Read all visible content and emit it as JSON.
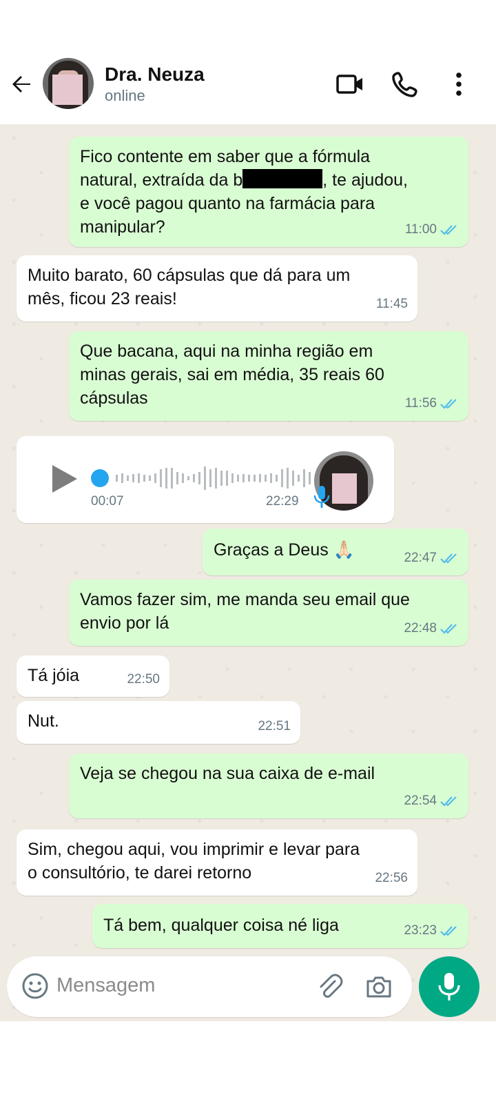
{
  "header": {
    "contact_name": "Dra. Neuza",
    "status": "online"
  },
  "messages": [
    {
      "direction": "out",
      "text_before": "Fico contente em saber que a fórmula\nnatural, extraída da b",
      "text_after": ", te ajudou,\ne você pagou quanto na farmácia para\nmanipular?",
      "time": "11:00",
      "read": true
    },
    {
      "direction": "in",
      "text": "Muito barato, 60 cápsulas que dá para um\nmês, ficou 23 reais!",
      "time": "11:45"
    },
    {
      "direction": "out",
      "text": "Que bacana, aqui na minha região em\nminas gerais, sai em média, 35 reais 60\ncápsulas",
      "time": "11:56",
      "read": true
    },
    {
      "direction": "in",
      "type": "audio",
      "duration": "00:07",
      "time": "22:29"
    },
    {
      "direction": "out",
      "text": "Graças a Deus 🙏🏻",
      "time": "22:47",
      "read": true
    },
    {
      "direction": "out",
      "text": "Vamos fazer sim, me manda seu email que\nenvio por lá",
      "time": "22:48",
      "read": true
    },
    {
      "direction": "in",
      "text": "Tá jóia",
      "time": "22:50"
    },
    {
      "direction": "in",
      "text": "Nut.",
      "time": "22:51"
    },
    {
      "direction": "out",
      "text": "Veja se chegou na sua caixa de e-mail",
      "time": "22:54",
      "read": true
    },
    {
      "direction": "in",
      "text": "Sim, chegou aqui, vou imprimir e levar para\no consultório, te darei retorno",
      "time": "22:56"
    },
    {
      "direction": "out",
      "text": "Tá bem, qualquer coisa né liga",
      "time": "23:23",
      "read": true
    }
  ],
  "composer": {
    "placeholder": "Mensagem"
  },
  "colors": {
    "outgoing_bubble": "#d9fdd3",
    "incoming_bubble": "#ffffff",
    "chat_background": "#efeae2",
    "read_ticks": "#53bdeb",
    "accent": "#00a884"
  }
}
